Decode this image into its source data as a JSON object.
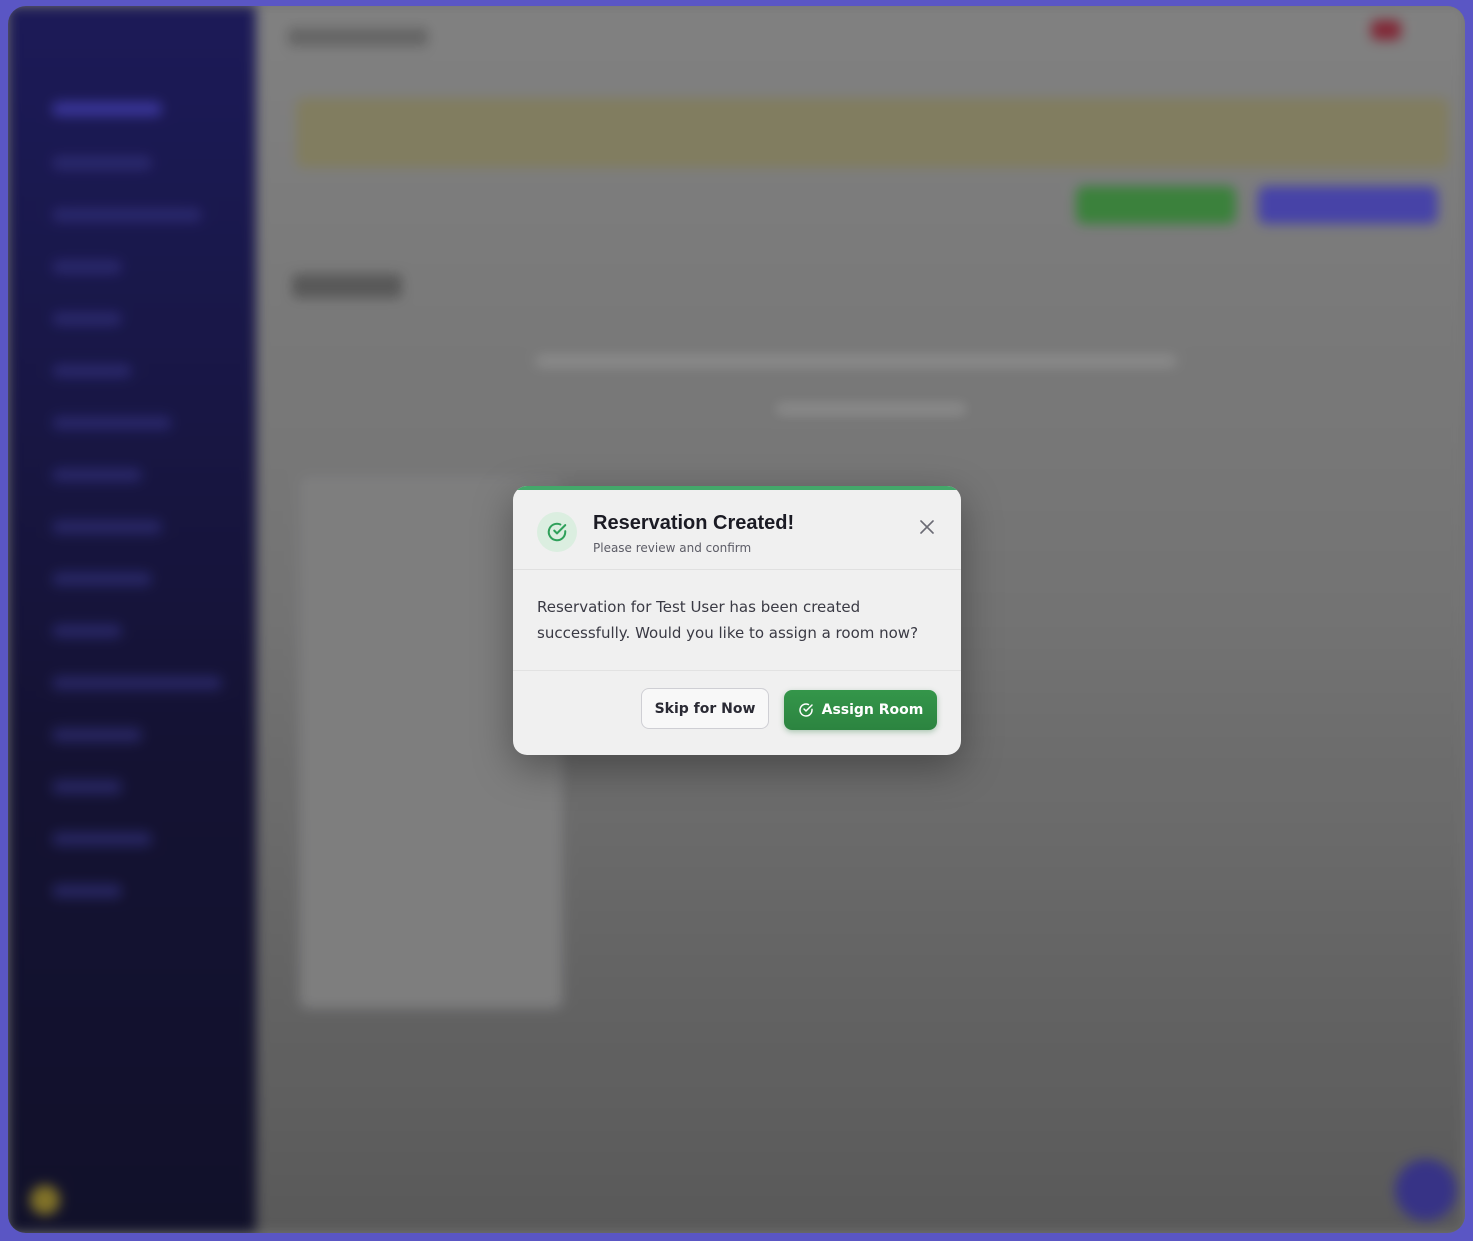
{
  "modal": {
    "title": "Reservation Created!",
    "subtitle": "Please review and confirm",
    "message": "Reservation for Test User has been created successfully. Would you like to assign a room now?",
    "close_icon": "close-icon",
    "status_icon": "check-circle-icon",
    "buttons": {
      "skip_label": "Skip for Now",
      "assign_label": "Assign Room",
      "assign_icon": "check-circle-icon"
    }
  },
  "colors": {
    "accent_green": "#2f8a44",
    "success_bar": "#43a86a",
    "sidebar": "#1d1b5e",
    "frame": "#5a56c4"
  }
}
